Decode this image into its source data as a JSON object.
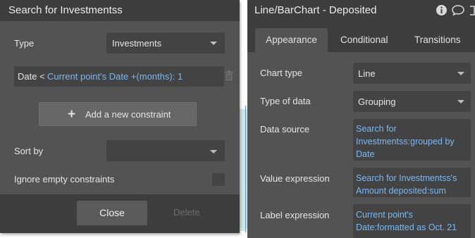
{
  "search_panel": {
    "title": "Search for Investmentss",
    "type_label": "Type",
    "type_value": "Investments",
    "constraint_field": "Date <",
    "constraint_expression": "Current point's Date +(months): 1",
    "add_constraint_label": "Add a new constraint",
    "sort_by_label": "Sort by",
    "sort_by_value": "",
    "ignore_empty_label": "Ignore empty constraints",
    "close_label": "Close",
    "delete_label": "Delete"
  },
  "chart_panel": {
    "title": "Line/BarChart - Deposited",
    "tabs": [
      {
        "label": "Appearance",
        "active": true
      },
      {
        "label": "Conditional",
        "active": false
      },
      {
        "label": "Transitions",
        "active": false
      }
    ],
    "chart_type_label": "Chart type",
    "chart_type_value": "Line",
    "type_of_data_label": "Type of data",
    "type_of_data_value": "Grouping",
    "data_source_label": "Data source",
    "data_source_value": "Search for\nInvestmentss:grouped by\nDate",
    "value_expression_label": "Value expression",
    "value_expression_value": "Search for Investmentss's\nAmount deposited:sum",
    "label_expression_label": "Label expression",
    "label_expression_value": "  Current point's\nDate:formatted as Oct. 21"
  },
  "colors": {
    "panel_bg": "#535353",
    "header_bg": "#3d3d3d",
    "input_bg": "#434343",
    "link_blue": "#7ab8f2"
  }
}
